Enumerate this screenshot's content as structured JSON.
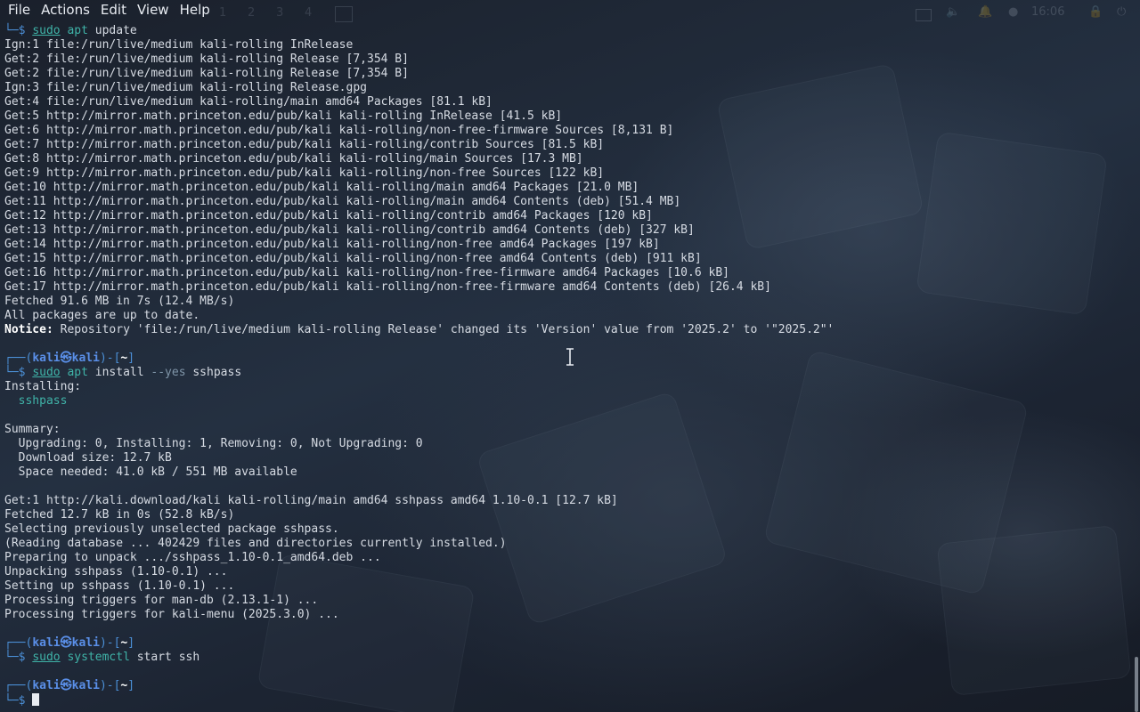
{
  "menubar": {
    "items": [
      "File",
      "Actions",
      "Edit",
      "View",
      "Help"
    ]
  },
  "panel": {
    "workspaces": [
      "1",
      "2",
      "3",
      "4"
    ],
    "clock": "16:06"
  },
  "terminal": {
    "lines": [
      [
        {
          "t": "└─",
          "c": "blue"
        },
        {
          "t": "$ ",
          "c": "blue"
        },
        {
          "t": "sudo",
          "c": "cmd-sudo"
        },
        {
          "t": " "
        },
        {
          "t": "apt",
          "c": "cmd-name"
        },
        {
          "t": " update"
        }
      ],
      [
        {
          "t": "Ign:1 file:/run/live/medium kali-rolling InRelease"
        }
      ],
      [
        {
          "t": "Get:2 file:/run/live/medium kali-rolling Release [7,354 B]"
        }
      ],
      [
        {
          "t": "Get:2 file:/run/live/medium kali-rolling Release [7,354 B]"
        }
      ],
      [
        {
          "t": "Ign:3 file:/run/live/medium kali-rolling Release.gpg"
        }
      ],
      [
        {
          "t": "Get:4 file:/run/live/medium kali-rolling/main amd64 Packages [81.1 kB]"
        }
      ],
      [
        {
          "t": "Get:5 http://mirror.math.princeton.edu/pub/kali kali-rolling InRelease [41.5 kB]"
        }
      ],
      [
        {
          "t": "Get:6 http://mirror.math.princeton.edu/pub/kali kali-rolling/non-free-firmware Sources [8,131 B]"
        }
      ],
      [
        {
          "t": "Get:7 http://mirror.math.princeton.edu/pub/kali kali-rolling/contrib Sources [81.5 kB]"
        }
      ],
      [
        {
          "t": "Get:8 http://mirror.math.princeton.edu/pub/kali kali-rolling/main Sources [17.3 MB]"
        }
      ],
      [
        {
          "t": "Get:9 http://mirror.math.princeton.edu/pub/kali kali-rolling/non-free Sources [122 kB]"
        }
      ],
      [
        {
          "t": "Get:10 http://mirror.math.princeton.edu/pub/kali kali-rolling/main amd64 Packages [21.0 MB]"
        }
      ],
      [
        {
          "t": "Get:11 http://mirror.math.princeton.edu/pub/kali kali-rolling/main amd64 Contents (deb) [51.4 MB]"
        }
      ],
      [
        {
          "t": "Get:12 http://mirror.math.princeton.edu/pub/kali kali-rolling/contrib amd64 Packages [120 kB]"
        }
      ],
      [
        {
          "t": "Get:13 http://mirror.math.princeton.edu/pub/kali kali-rolling/contrib amd64 Contents (deb) [327 kB]"
        }
      ],
      [
        {
          "t": "Get:14 http://mirror.math.princeton.edu/pub/kali kali-rolling/non-free amd64 Packages [197 kB]"
        }
      ],
      [
        {
          "t": "Get:15 http://mirror.math.princeton.edu/pub/kali kali-rolling/non-free amd64 Contents (deb) [911 kB]"
        }
      ],
      [
        {
          "t": "Get:16 http://mirror.math.princeton.edu/pub/kali kali-rolling/non-free-firmware amd64 Packages [10.6 kB]"
        }
      ],
      [
        {
          "t": "Get:17 http://mirror.math.princeton.edu/pub/kali kali-rolling/non-free-firmware amd64 Contents (deb) [26.4 kB]"
        }
      ],
      [
        {
          "t": "Fetched 91.6 MB in 7s (12.4 MB/s)"
        }
      ],
      [
        {
          "t": "All packages are up to date."
        }
      ],
      [
        {
          "t": "Notice:",
          "c": "bold-white"
        },
        {
          "t": " Repository 'file:/run/live/medium kali-rolling Release' changed its 'Version' value from '2025.2' to '\"2025.2\"'"
        }
      ],
      [
        {
          "t": ""
        }
      ],
      [
        {
          "t": "┌──(",
          "c": "blue"
        },
        {
          "t": "kali㉿kali",
          "c": "prompt-user"
        },
        {
          "t": ")-[",
          "c": "blue"
        },
        {
          "t": "~",
          "c": "bold-white"
        },
        {
          "t": "]",
          "c": "blue"
        }
      ],
      [
        {
          "t": "└─",
          "c": "blue"
        },
        {
          "t": "$ ",
          "c": "blue"
        },
        {
          "t": "sudo",
          "c": "cmd-sudo"
        },
        {
          "t": " "
        },
        {
          "t": "apt",
          "c": "cmd-name"
        },
        {
          "t": " install "
        },
        {
          "t": "--yes",
          "c": "opt"
        },
        {
          "t": " sshpass"
        }
      ],
      [
        {
          "t": "Installing:"
        }
      ],
      [
        {
          "t": "  "
        },
        {
          "t": "sshpass",
          "c": "green"
        }
      ],
      [
        {
          "t": ""
        }
      ],
      [
        {
          "t": "Summary:"
        }
      ],
      [
        {
          "t": "  Upgrading: 0, Installing: 1, Removing: 0, Not Upgrading: 0"
        }
      ],
      [
        {
          "t": "  Download size: 12.7 kB"
        }
      ],
      [
        {
          "t": "  Space needed: 41.0 kB / 551 MB available"
        }
      ],
      [
        {
          "t": ""
        }
      ],
      [
        {
          "t": "Get:1 http://kali.download/kali kali-rolling/main amd64 sshpass amd64 1.10-0.1 [12.7 kB]"
        }
      ],
      [
        {
          "t": "Fetched 12.7 kB in 0s (52.8 kB/s)"
        }
      ],
      [
        {
          "t": "Selecting previously unselected package sshpass."
        }
      ],
      [
        {
          "t": "(Reading database ... 402429 files and directories currently installed.)"
        }
      ],
      [
        {
          "t": "Preparing to unpack .../sshpass_1.10-0.1_amd64.deb ..."
        }
      ],
      [
        {
          "t": "Unpacking sshpass (1.10-0.1) ..."
        }
      ],
      [
        {
          "t": "Setting up sshpass (1.10-0.1) ..."
        }
      ],
      [
        {
          "t": "Processing triggers for man-db (2.13.1-1) ..."
        }
      ],
      [
        {
          "t": "Processing triggers for kali-menu (2025.3.0) ..."
        }
      ],
      [
        {
          "t": ""
        }
      ],
      [
        {
          "t": "┌──(",
          "c": "blue"
        },
        {
          "t": "kali㉿kali",
          "c": "prompt-user"
        },
        {
          "t": ")-[",
          "c": "blue"
        },
        {
          "t": "~",
          "c": "bold-white"
        },
        {
          "t": "]",
          "c": "blue"
        }
      ],
      [
        {
          "t": "└─",
          "c": "blue"
        },
        {
          "t": "$ ",
          "c": "blue"
        },
        {
          "t": "sudo",
          "c": "cmd-sudo"
        },
        {
          "t": " "
        },
        {
          "t": "systemctl",
          "c": "cmd-name"
        },
        {
          "t": " start ssh"
        }
      ],
      [
        {
          "t": ""
        }
      ],
      [
        {
          "t": "┌──(",
          "c": "blue"
        },
        {
          "t": "kali㉿kali",
          "c": "prompt-user"
        },
        {
          "t": ")-[",
          "c": "blue"
        },
        {
          "t": "~",
          "c": "bold-white"
        },
        {
          "t": "]",
          "c": "blue"
        }
      ],
      [
        {
          "t": "└─",
          "c": "blue"
        },
        {
          "t": "$ ",
          "c": "blue"
        },
        {
          "t": "",
          "cursor": true
        }
      ]
    ]
  },
  "colors": {
    "prompt_blue": "#4b8fd6",
    "command_teal": "#3fb3a8",
    "text": "#d6dbe3",
    "background": "#1b2230"
  }
}
